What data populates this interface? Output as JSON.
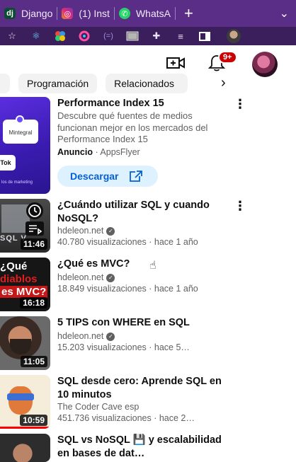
{
  "browser": {
    "tabs": [
      {
        "label": "Django",
        "icon": "django-icon",
        "color": "#0c4b33"
      },
      {
        "label": "(1) Inst",
        "icon": "instagram-icon",
        "color": "#d62976"
      },
      {
        "label": "WhatsA",
        "icon": "whatsapp-icon",
        "color": "#25d366"
      }
    ],
    "new_tab_glyph": "+",
    "tab_menu_glyph": "⌄",
    "toolbar_icons": [
      "star-icon",
      "react-icon",
      "extension-color-icon",
      "extension-ring-icon",
      "code-icon",
      "image-icon",
      "puzzle-icon",
      "playlist-icon",
      "sidebar-icon"
    ]
  },
  "header": {
    "notification_badge": "9+"
  },
  "chips": [
    {
      "label": "Programación"
    },
    {
      "label": "Relacionados"
    }
  ],
  "chip_next_glyph": "›",
  "ad": {
    "title": "Performance Index 15",
    "description": "Descubre qué fuentes de medios funcionan mejor en los mercados del Performance Index 15",
    "label": "Anuncio",
    "advertiser": "· AppsFlyer",
    "cta": "Descargar",
    "thumb_text_1": "Mintegral",
    "thumb_text_2": "Tok",
    "thumb_footer": "los de marketing"
  },
  "videos": [
    {
      "title": "¿Cuándo utilizar SQL y cuando NoSQL?",
      "channel": "hdeleon.net",
      "verified": true,
      "views": "40.780 visualizaciones",
      "age": "· hace 1 año",
      "duration": "11:46",
      "thumb_text": "SQL V"
    },
    {
      "title": "¿Qué es MVC?",
      "channel": "hdeleon.net",
      "verified": true,
      "views": "18.849 visualizaciones",
      "age": "· hace 1 año",
      "duration": "16:18",
      "thumb_lines": [
        "¿Qué",
        "diablos",
        "es MVC?"
      ]
    },
    {
      "title": "5 TIPS con WHERE en SQL",
      "channel": "hdeleon.net",
      "verified": true,
      "views": "15.203 visualizaciones",
      "age": "· hace 5…",
      "duration": "11:05"
    },
    {
      "title": "SQL desde cero: Aprende SQL en 10 minutos",
      "channel": "The Coder Cave esp",
      "verified": false,
      "views": "451.736 visualizaciones",
      "age": "· hace 2…",
      "duration": "10:59"
    },
    {
      "title": "SQL vs NoSQL 💾 y escalabilidad en bases de dat…",
      "channel": "",
      "verified": false,
      "views": "",
      "age": "",
      "duration": ""
    }
  ]
}
